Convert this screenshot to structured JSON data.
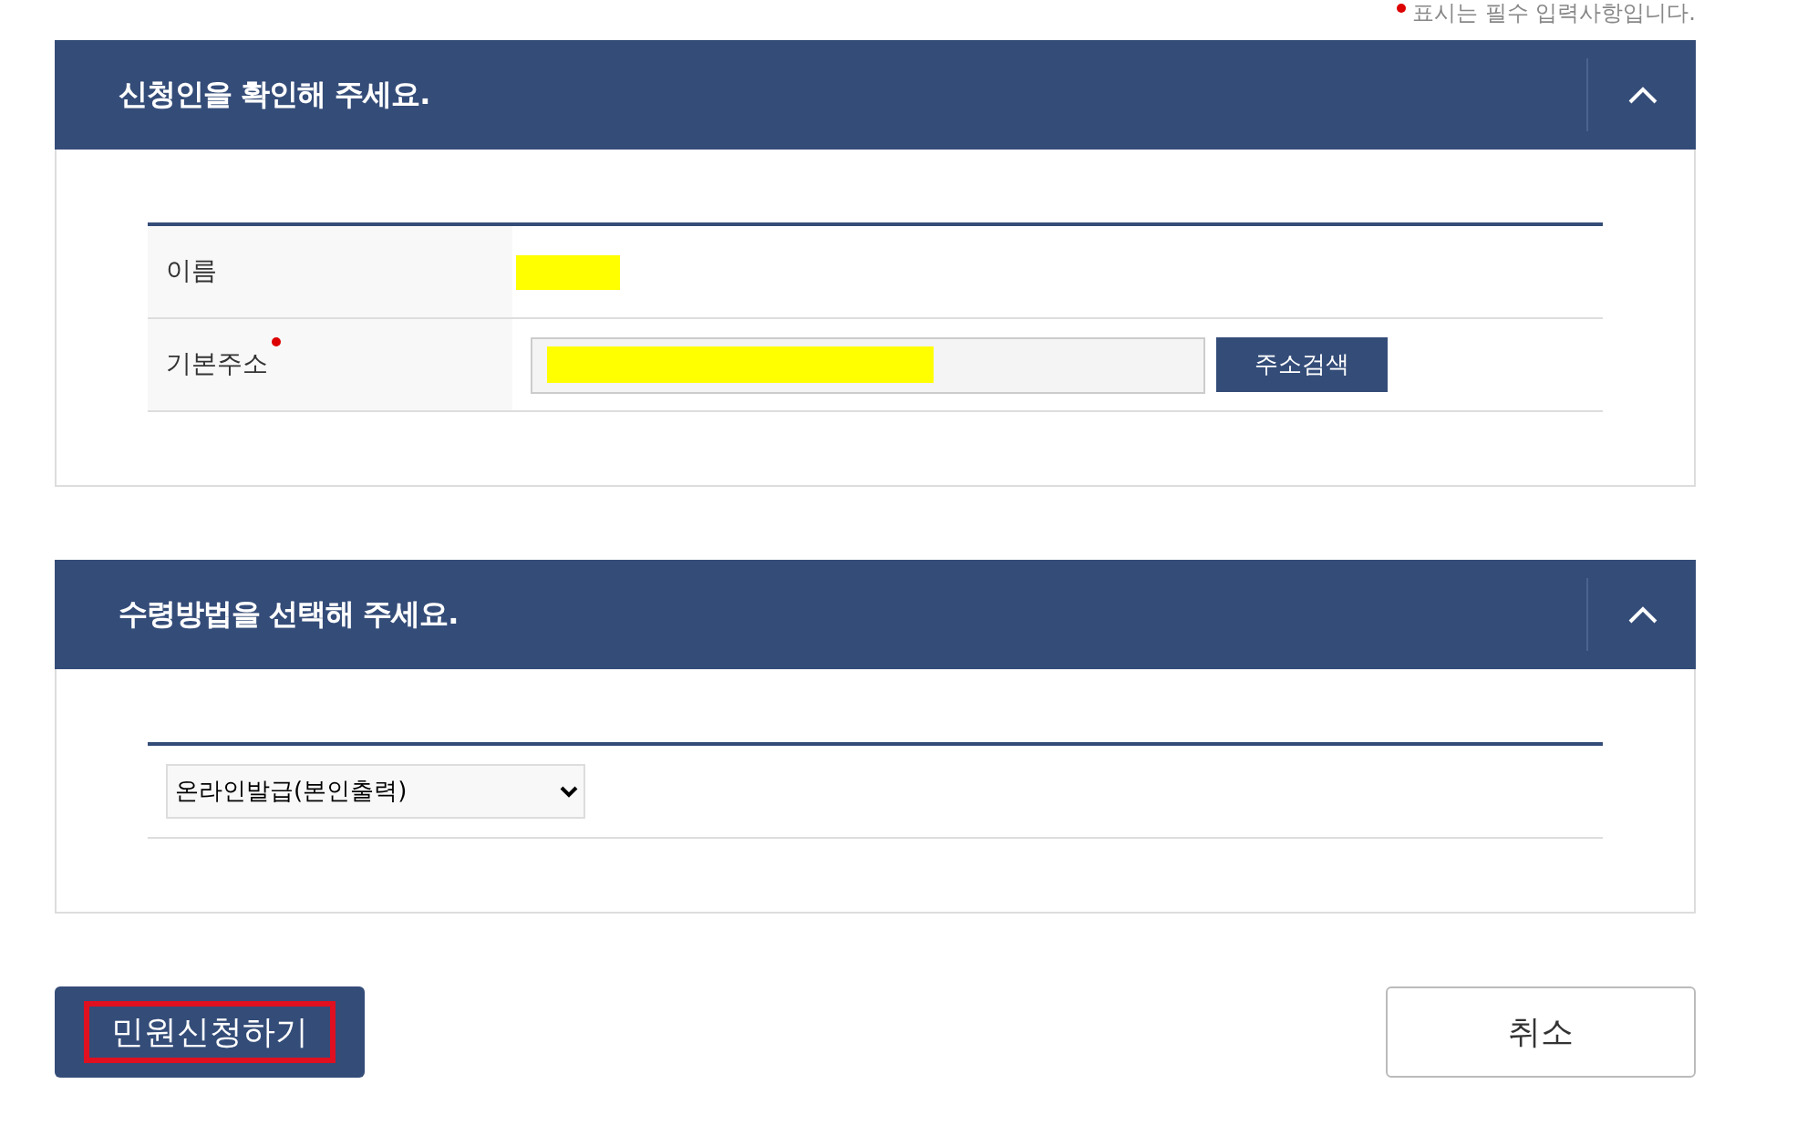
{
  "required_note": "표시는 필수 입력사항입니다.",
  "sections": [
    {
      "title": "신청인을 확인해 주세요.",
      "expanded": true,
      "kind": "fields",
      "rows": [
        {
          "label": "이름",
          "required": false,
          "kind": "text",
          "redacted": true
        },
        {
          "label": "기본주소",
          "required": true,
          "kind": "address",
          "redacted": true,
          "button": "주소검색"
        }
      ]
    },
    {
      "title": "수령방법을 선택해 주세요.",
      "expanded": true,
      "kind": "select",
      "value": "온라인발급(본인출력)"
    }
  ],
  "actions": [
    {
      "label": "민원신청하기",
      "kind": "primary",
      "highlighted": true
    },
    {
      "label": "취소",
      "kind": "secondary",
      "highlighted": false
    }
  ]
}
